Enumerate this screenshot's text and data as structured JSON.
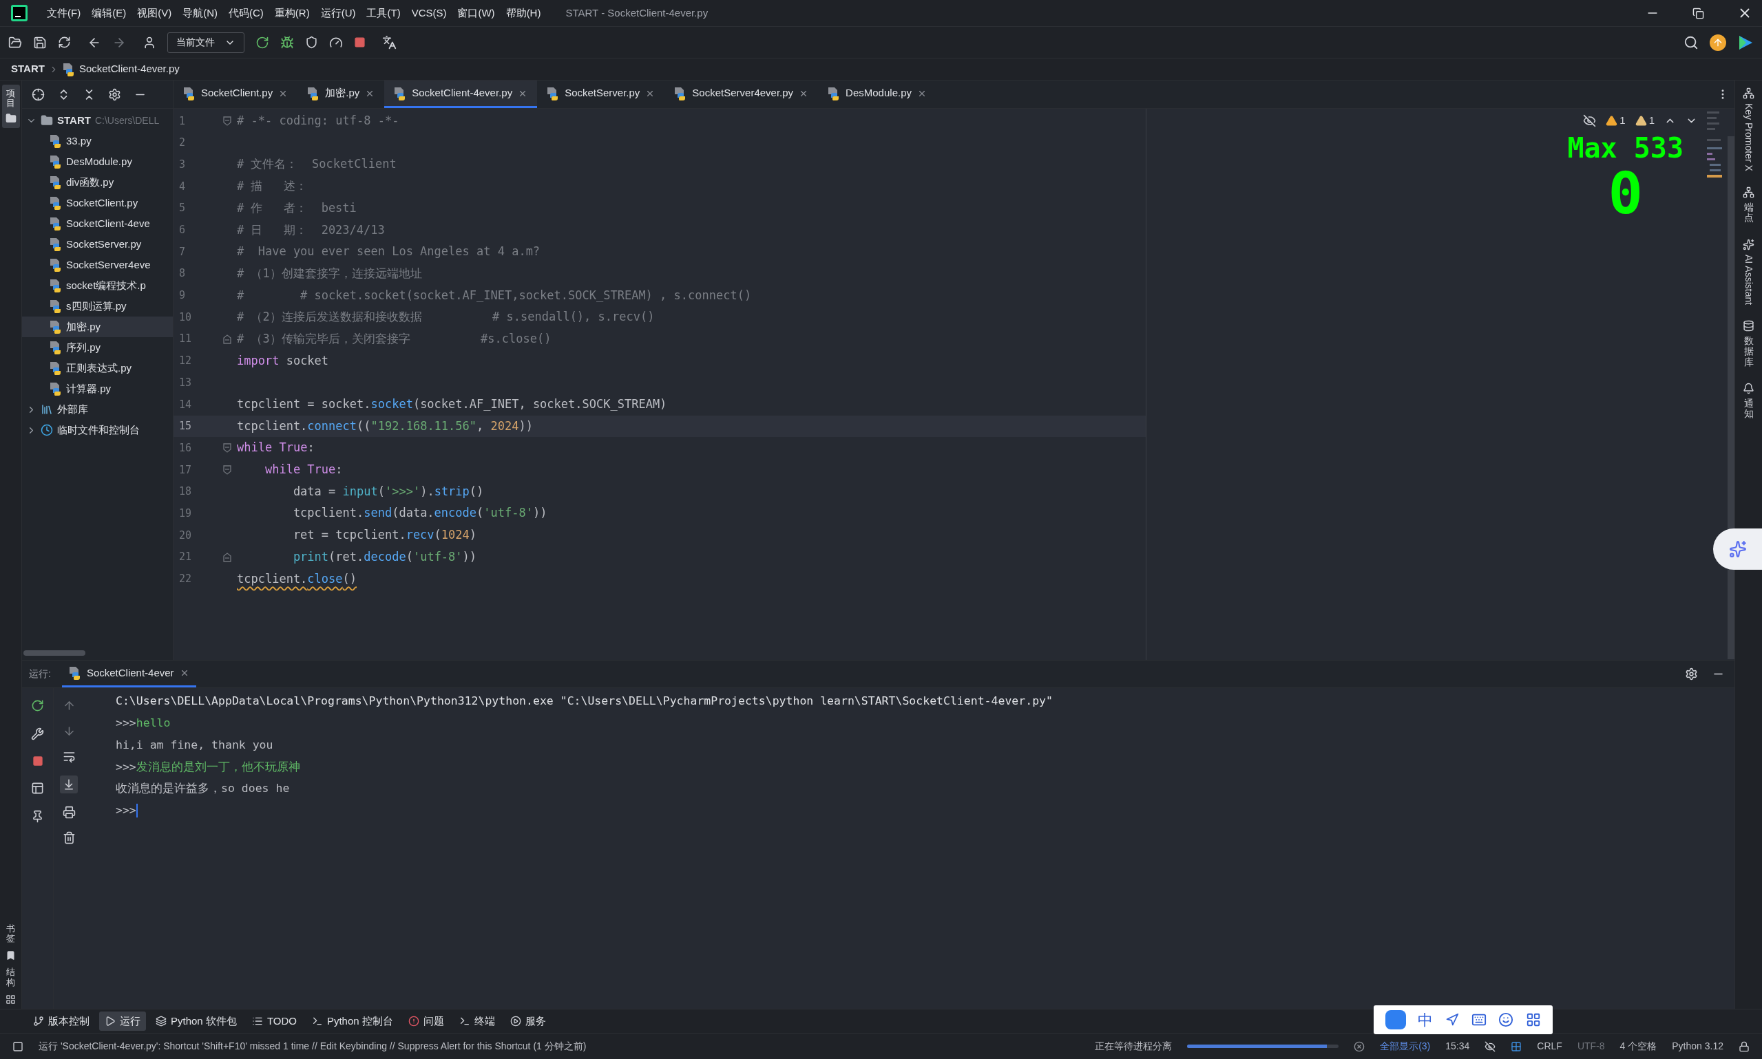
{
  "window": {
    "title": "START - SocketClient-4ever.py"
  },
  "menu": [
    "文件(F)",
    "编辑(E)",
    "视图(V)",
    "导航(N)",
    "代码(C)",
    "重构(R)",
    "运行(U)",
    "工具(T)",
    "VCS(S)",
    "窗口(W)",
    "帮助(H)"
  ],
  "toolbar": {
    "run_config": "当前文件"
  },
  "breadcrumb": [
    "START",
    "SocketClient-4ever.py"
  ],
  "left_stripe": {
    "top": [
      "项目"
    ],
    "bottom": [
      "书签",
      "结构"
    ]
  },
  "right_stripe": [
    {
      "label": "Key Promoter X",
      "kind": "latin"
    },
    {
      "label": "端点",
      "kind": "cjk"
    },
    {
      "label": "AI Assistant",
      "kind": "latin"
    },
    {
      "label": "数据库",
      "kind": "cjk"
    },
    {
      "label": "通知",
      "kind": "cjk"
    }
  ],
  "project": {
    "tree": [
      {
        "label": "START",
        "path": "C:\\Users\\DELL",
        "kind": "folder",
        "expanded": true,
        "selected": false,
        "children": [
          {
            "label": "33.py",
            "kind": "python",
            "selected": false
          },
          {
            "label": "DesModule.py",
            "kind": "python",
            "selected": false
          },
          {
            "label": "div函数.py",
            "kind": "python",
            "selected": false
          },
          {
            "label": "SocketClient.py",
            "kind": "python",
            "selected": false
          },
          {
            "label": "SocketClient-4eve",
            "kind": "python",
            "selected": false
          },
          {
            "label": "SocketServer.py",
            "kind": "python",
            "selected": false
          },
          {
            "label": "SocketServer4eve",
            "kind": "python",
            "selected": false
          },
          {
            "label": "socket编程技术.p",
            "kind": "python",
            "selected": false
          },
          {
            "label": "s四则运算.py",
            "kind": "python",
            "selected": false
          },
          {
            "label": "加密.py",
            "kind": "python",
            "selected": true
          },
          {
            "label": "序列.py",
            "kind": "python",
            "selected": false
          },
          {
            "label": "正则表达式.py",
            "kind": "python",
            "selected": false
          },
          {
            "label": "计算器.py",
            "kind": "python",
            "selected": false
          }
        ]
      },
      {
        "label": "外部库",
        "kind": "library",
        "expanded": false,
        "selected": false
      },
      {
        "label": "临时文件和控制台",
        "kind": "scratch",
        "expanded": false,
        "selected": false
      }
    ]
  },
  "editor": {
    "tabs": [
      {
        "label": "SocketClient.py",
        "selected": false
      },
      {
        "label": "加密.py",
        "selected": false
      },
      {
        "label": "SocketClient-4ever.py",
        "selected": true
      },
      {
        "label": "SocketServer.py",
        "selected": false
      },
      {
        "label": "SocketServer4ever.py",
        "selected": false
      },
      {
        "label": "DesModule.py",
        "selected": false
      }
    ],
    "inspections": [
      {
        "count": "1",
        "color": "#f0a732"
      },
      {
        "count": "1",
        "color": "#e5c07b"
      }
    ],
    "overlay": {
      "title": "Max 533",
      "value": "0"
    },
    "lines": [
      {
        "number": "1",
        "kind": "fold_start",
        "current": false,
        "warning": false,
        "tokens": [
          {
            "text": "# -*- coding: utf-8 -*-",
            "kind": "comment"
          }
        ]
      },
      {
        "number": "2",
        "current": false
      },
      {
        "number": "3",
        "current": false,
        "warning": false,
        "tokens": [
          {
            "text": "# 文件名：  SocketClient",
            "kind": "comment"
          }
        ]
      },
      {
        "number": "4",
        "current": false,
        "warning": false,
        "tokens": [
          {
            "text": "# 描   述：",
            "kind": "comment"
          }
        ]
      },
      {
        "number": "5",
        "current": false,
        "warning": false,
        "tokens": [
          {
            "text": "# 作   者：  besti",
            "kind": "comment"
          }
        ]
      },
      {
        "number": "6",
        "current": false,
        "warning": false,
        "tokens": [
          {
            "text": "# 日   期：  2023/4/13",
            "kind": "comment"
          }
        ]
      },
      {
        "number": "7",
        "current": false,
        "warning": false,
        "tokens": [
          {
            "text": "#  Have you ever seen Los Angeles at 4 a.m?",
            "kind": "comment"
          }
        ]
      },
      {
        "number": "8",
        "current": false,
        "warning": false,
        "tokens": [
          {
            "text": "# （1）创建套接字，连接远端地址",
            "kind": "comment"
          }
        ]
      },
      {
        "number": "9",
        "current": false,
        "warning": false,
        "tokens": [
          {
            "text": "#        # socket.socket(socket.AF_INET,socket.SOCK_STREAM) , s.connect()",
            "kind": "comment"
          }
        ]
      },
      {
        "number": "10",
        "current": false,
        "warning": false,
        "tokens": [
          {
            "text": "# （2）连接后发送数据和接收数据          # s.sendall(), s.recv()",
            "kind": "comment"
          }
        ]
      },
      {
        "number": "11",
        "kind": "fold_end",
        "current": false,
        "warning": false,
        "tokens": [
          {
            "text": "# （3）传输完毕后，关闭套接字          #s.close()",
            "kind": "comment"
          }
        ]
      },
      {
        "number": "12",
        "current": false,
        "warning": false,
        "tokens": [
          {
            "text": "import",
            "kind": "keyword"
          },
          {
            "text": " socket",
            "kind": "plain"
          }
        ]
      },
      {
        "number": "13",
        "current": false
      },
      {
        "number": "14",
        "current": false,
        "warning": false,
        "tokens": [
          {
            "text": "tcpclient = socket.",
            "kind": "plain"
          },
          {
            "text": "socket",
            "kind": "function"
          },
          {
            "text": "(socket.AF_INET, socket.SOCK_STREAM)",
            "kind": "plain"
          }
        ]
      },
      {
        "number": "15",
        "current": true,
        "warning": false,
        "tokens": [
          {
            "text": "tcpclient.",
            "kind": "plain"
          },
          {
            "text": "connect",
            "kind": "function"
          },
          {
            "text": "((",
            "kind": "plain"
          },
          {
            "text": "\"192.168.11.56\"",
            "kind": "string"
          },
          {
            "text": ", ",
            "kind": "plain"
          },
          {
            "text": "2024",
            "kind": "number"
          },
          {
            "text": "))",
            "kind": "plain"
          }
        ]
      },
      {
        "number": "16",
        "kind": "fold_start",
        "current": false,
        "warning": false,
        "tokens": [
          {
            "text": "while",
            "kind": "keyword"
          },
          {
            "text": " True",
            "kind": "keyword"
          },
          {
            "text": ":",
            "kind": "plain"
          }
        ]
      },
      {
        "number": "17",
        "kind": "fold_start",
        "current": false,
        "warning": false,
        "tokens": [
          {
            "text": "    while",
            "kind": "keyword"
          },
          {
            "text": " True",
            "kind": "keyword"
          },
          {
            "text": ":",
            "kind": "plain"
          }
        ]
      },
      {
        "number": "18",
        "current": false,
        "warning": false,
        "tokens": [
          {
            "text": "        data = ",
            "kind": "plain"
          },
          {
            "text": "input",
            "kind": "builtin"
          },
          {
            "text": "(",
            "kind": "plain"
          },
          {
            "text": "'>>>'",
            "kind": "string"
          },
          {
            "text": ").",
            "kind": "plain"
          },
          {
            "text": "strip",
            "kind": "function"
          },
          {
            "text": "()",
            "kind": "plain"
          }
        ]
      },
      {
        "number": "19",
        "current": false,
        "warning": false,
        "tokens": [
          {
            "text": "        tcpclient.",
            "kind": "plain"
          },
          {
            "text": "send",
            "kind": "function"
          },
          {
            "text": "(data.",
            "kind": "plain"
          },
          {
            "text": "encode",
            "kind": "function"
          },
          {
            "text": "(",
            "kind": "plain"
          },
          {
            "text": "'utf-8'",
            "kind": "string"
          },
          {
            "text": "))",
            "kind": "plain"
          }
        ]
      },
      {
        "number": "20",
        "current": false,
        "warning": false,
        "tokens": [
          {
            "text": "        ret = tcpclient.",
            "kind": "plain"
          },
          {
            "text": "recv",
            "kind": "function"
          },
          {
            "text": "(",
            "kind": "plain"
          },
          {
            "text": "1024",
            "kind": "number"
          },
          {
            "text": ")",
            "kind": "plain"
          }
        ]
      },
      {
        "number": "21",
        "kind": "fold_end",
        "current": false,
        "warning": false,
        "tokens": [
          {
            "text": "        print",
            "kind": "builtin"
          },
          {
            "text": "(ret.",
            "kind": "plain"
          },
          {
            "text": "decode",
            "kind": "function"
          },
          {
            "text": "(",
            "kind": "plain"
          },
          {
            "text": "'utf-8'",
            "kind": "string"
          },
          {
            "text": "))",
            "kind": "plain"
          }
        ]
      },
      {
        "number": "22",
        "current": false,
        "warning": true,
        "tokens": [
          {
            "text": "tcpclient.",
            "kind": "plain"
          },
          {
            "text": "close",
            "kind": "function"
          },
          {
            "text": "()",
            "kind": "plain"
          }
        ]
      }
    ]
  },
  "run": {
    "label": "运行:",
    "tab": "SocketClient-4ever",
    "console": [
      {
        "cursor": false,
        "parts": [
          {
            "text": "C:\\Users\\DELL\\AppData\\Local\\Programs\\Python\\Python312\\python.exe \"C:\\Users\\DELL\\PycharmProjects\\python learn\\START\\SocketClient-4ever.py\"",
            "kind": "system"
          }
        ]
      },
      {
        "cursor": false,
        "parts": [
          {
            "text": ">>>",
            "kind": "output"
          },
          {
            "text": "hello",
            "kind": "input"
          }
        ]
      },
      {
        "cursor": false,
        "parts": [
          {
            "text": "hi,i am fine, thank you",
            "kind": "output"
          }
        ]
      },
      {
        "cursor": false,
        "parts": [
          {
            "text": ">>>",
            "kind": "output"
          },
          {
            "text": "发消息的是刘一丁，他不玩原神",
            "kind": "input"
          }
        ]
      },
      {
        "cursor": false,
        "parts": [
          {
            "text": "收消息的是许益多，so does he",
            "kind": "output"
          }
        ]
      },
      {
        "cursor": true,
        "parts": [
          {
            "text": ">>>",
            "kind": "output"
          }
        ]
      }
    ]
  },
  "tool_tabs": [
    {
      "label": "版本控制",
      "kind": "vcs",
      "selected": false
    },
    {
      "label": "运行",
      "kind": "run",
      "selected": true
    },
    {
      "label": "Python 软件包",
      "kind": "packages",
      "selected": false
    },
    {
      "label": "TODO",
      "kind": "todo",
      "selected": false
    },
    {
      "label": "Python 控制台",
      "kind": "console",
      "selected": false
    },
    {
      "label": "问题",
      "kind": "problems",
      "selected": false
    },
    {
      "label": "终端",
      "kind": "terminal",
      "selected": false
    },
    {
      "label": "服务",
      "kind": "services",
      "selected": false
    }
  ],
  "status_bar": {
    "message": "运行 'SocketClient-4ever.py': Shortcut 'Shift+F10' missed 1 time // Edit Keybinding // Suppress Alert for this Shortcut (1 分钟之前)",
    "process": {
      "label": "正在等待进程分离",
      "level": 0.92
    },
    "show_all": "全部显示(3)",
    "position": "15:34",
    "line_separator": "CRLF",
    "encoding": "UTF-8",
    "indent": "4 个空格",
    "interpreter": "Python 3.12"
  },
  "ime": {
    "mode": "中"
  }
}
